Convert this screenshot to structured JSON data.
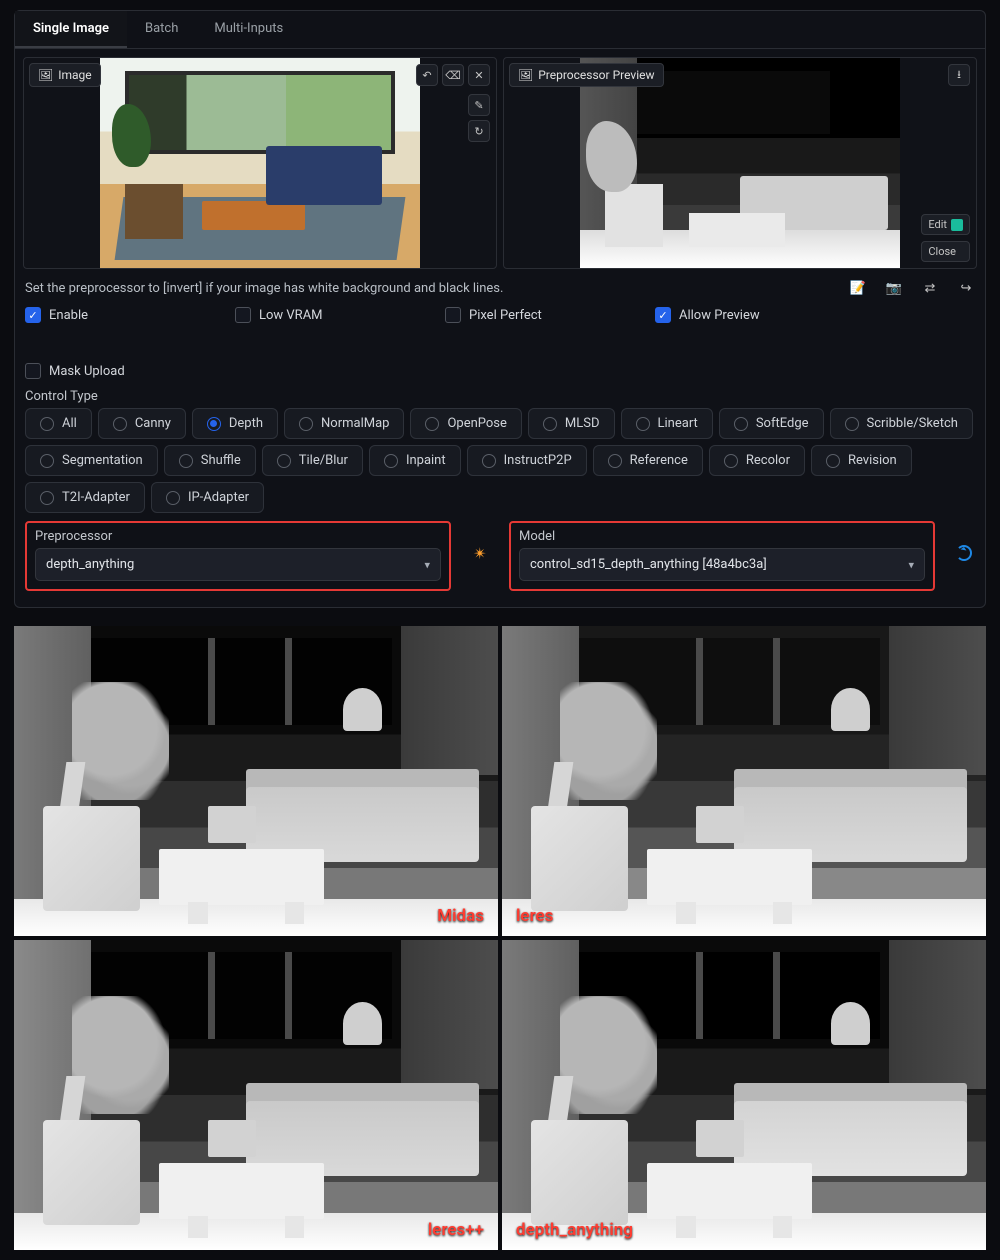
{
  "tabs": [
    "Single Image",
    "Batch",
    "Multi-Inputs"
  ],
  "active_tab": 0,
  "image_label": "Image",
  "preview_label": "Preprocessor Preview",
  "edit_btn": "Edit",
  "close_btn": "Close",
  "hint_text": "Set the preprocessor to [invert] if your image has white background and black lines.",
  "checkboxes": [
    {
      "label": "Enable",
      "checked": true
    },
    {
      "label": "Low VRAM",
      "checked": false
    },
    {
      "label": "Pixel Perfect",
      "checked": false
    },
    {
      "label": "Allow Preview",
      "checked": true
    },
    {
      "label": "Mask Upload",
      "checked": false
    }
  ],
  "control_type_label": "Control Type",
  "control_types": [
    "All",
    "Canny",
    "Depth",
    "NormalMap",
    "OpenPose",
    "MLSD",
    "Lineart",
    "SoftEdge",
    "Scribble/Sketch",
    "Segmentation",
    "Shuffle",
    "Tile/Blur",
    "Inpaint",
    "InstructP2P",
    "Reference",
    "Recolor",
    "Revision",
    "T2I-Adapter",
    "IP-Adapter"
  ],
  "control_type_selected": "Depth",
  "preprocessor": {
    "label": "Preprocessor",
    "value": "depth_anything"
  },
  "model": {
    "label": "Model",
    "value": "control_sd15_depth_anything [48a4bc3a]"
  },
  "comparison_labels": [
    "Midas",
    "leres",
    "leres++",
    "depth_anything"
  ],
  "tool_icons": {
    "undo": "↶",
    "erase": "⌫",
    "close": "✕",
    "pen": "✎",
    "reload": "↻",
    "download": "⭳",
    "note": "📝",
    "camera": "📷",
    "swap": "⇄",
    "send": "↪"
  }
}
